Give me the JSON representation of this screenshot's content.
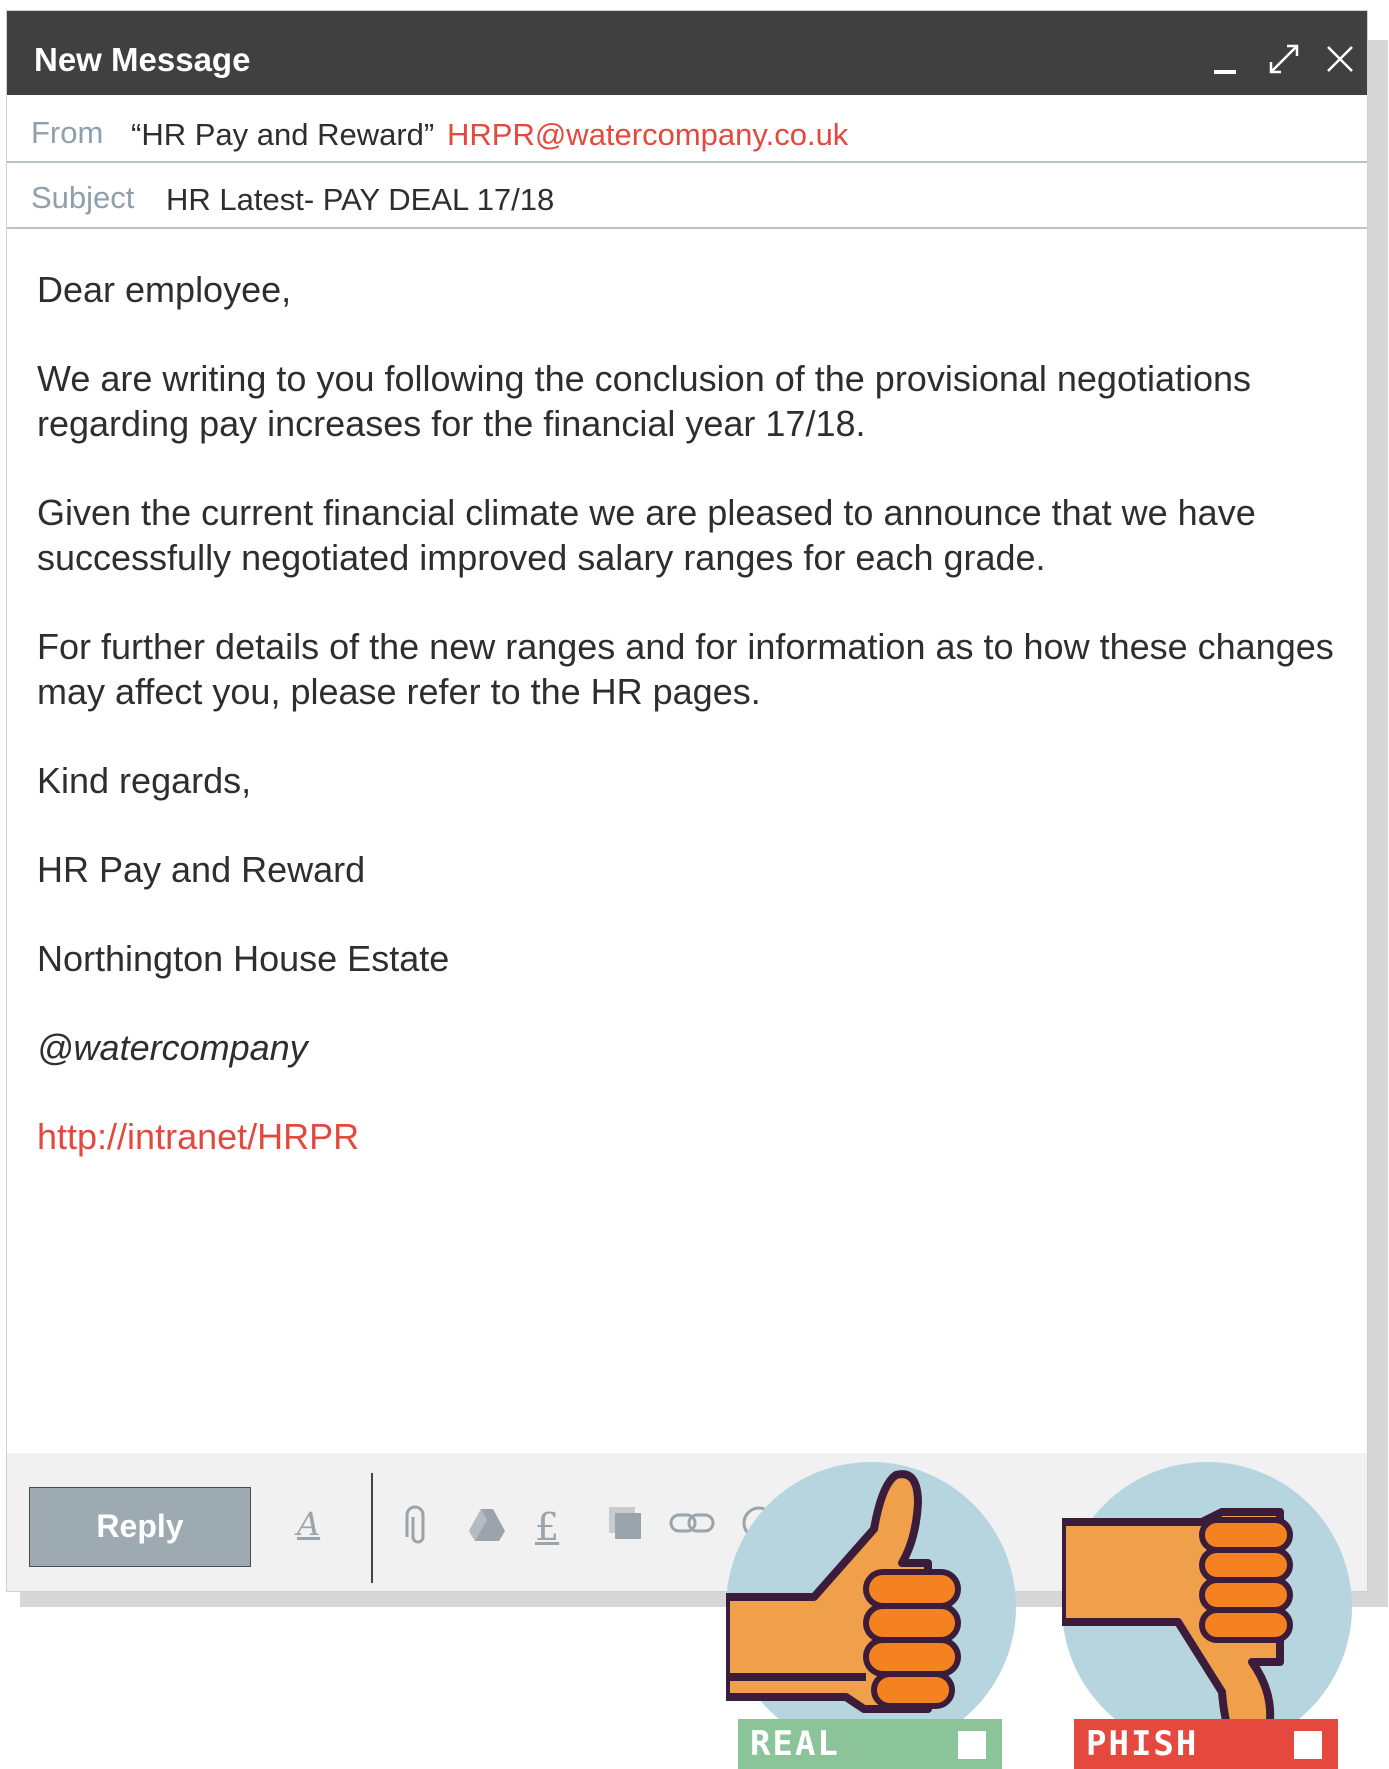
{
  "window": {
    "title": "New Message",
    "controls": [
      "minimize-icon",
      "expand-icon",
      "close-icon"
    ]
  },
  "header": {
    "from_label": "From",
    "from_name": "“HR Pay and Reward”",
    "from_email": "HRPR@watercompany.co.uk",
    "subject_label": "Subject",
    "subject": "HR Latest- PAY DEAL 17/18"
  },
  "message": {
    "greeting": "Dear employee,",
    "paragraphs": [
      "We are writing to you following the conclusion of the provisional negotiations regarding pay increases for the financial year 17/18.",
      "Given the current financial climate we are pleased to announce that we have successfully negotiated improved salary ranges for each grade.",
      "For further details of the new ranges and for information as to how these changes may affect you, please refer to the HR pages."
    ],
    "closing": "Kind regards,",
    "signature_name": "HR Pay and Reward",
    "signature_org": "Northington House Estate",
    "signature_handle": "@watercompany",
    "signature_link": "http://intranet/HRPR"
  },
  "toolbar": {
    "reply_label": "Reply",
    "icons": [
      "format-text-icon",
      "attach-icon",
      "drive-icon",
      "pound-icon",
      "photo-icon",
      "link-icon"
    ]
  },
  "vote": {
    "real_label": "REAL",
    "phish_label": "PHISH",
    "real_color": "#8cc49a",
    "phish_color": "#e5493e"
  }
}
